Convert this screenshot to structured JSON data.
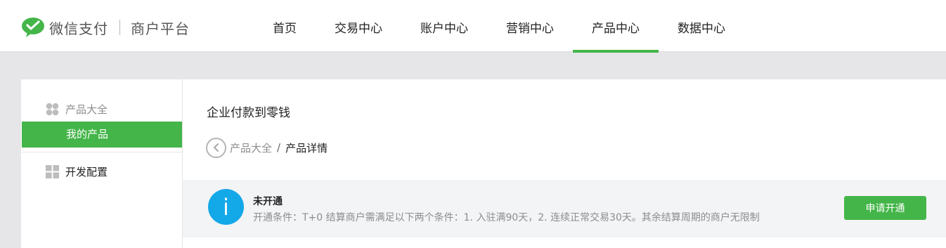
{
  "header": {
    "brand_name": "微信支付",
    "brand_sub": "商户平台",
    "nav": [
      {
        "label": "首页",
        "active": false
      },
      {
        "label": "交易中心",
        "active": false
      },
      {
        "label": "账户中心",
        "active": false
      },
      {
        "label": "营销中心",
        "active": false
      },
      {
        "label": "产品中心",
        "active": true
      },
      {
        "label": "数据中心",
        "active": false
      }
    ]
  },
  "sidebar": {
    "group_label": "产品大全",
    "active_item": "我的产品",
    "dev_label": "开发配置"
  },
  "main": {
    "title": "企业付款到零钱",
    "breadcrumb": {
      "parent": "产品大全",
      "separator": "/",
      "current": "产品详情"
    },
    "notice": {
      "icon_char": "i",
      "title": "未开通",
      "description": "开通条件：T+0 结算商户需满足以下两个条件：1. 入驻满90天，2. 连续正常交易30天。其余结算周期的商户无限制",
      "action_label": "申请开通"
    }
  },
  "colors": {
    "accent": "#44b549",
    "info": "#13a8e8",
    "page_bg": "#e6e6e9"
  }
}
